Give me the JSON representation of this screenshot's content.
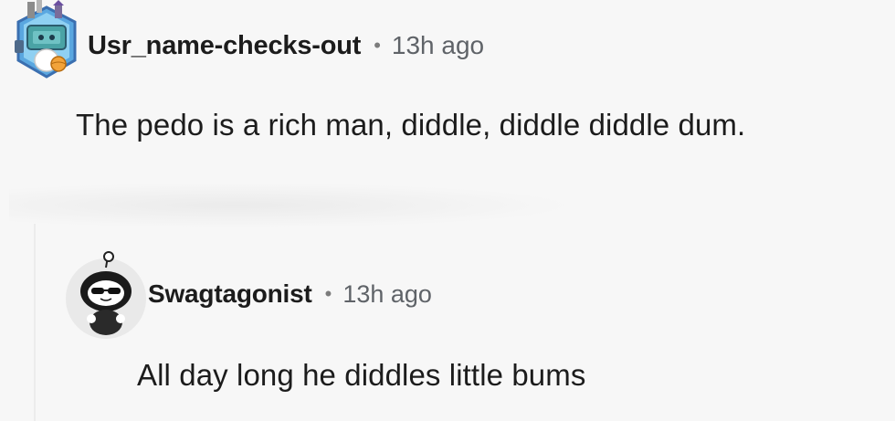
{
  "comments": [
    {
      "username": "Usr_name-checks-out",
      "separator": "•",
      "time": "13h ago",
      "text": "The pedo is a rich man, diddle, diddle diddle dum.",
      "avatar_icon": "snoo-avatar-chest-icon"
    },
    {
      "username": "Swagtagonist",
      "separator": "•",
      "time": "13h ago",
      "text": "All day long he diddles little bums",
      "avatar_icon": "snoo-avatar-sunglasses-icon"
    }
  ],
  "colors": {
    "background": "#f7f7f7",
    "text": "#1c1c1c",
    "meta": "#5f6368"
  }
}
